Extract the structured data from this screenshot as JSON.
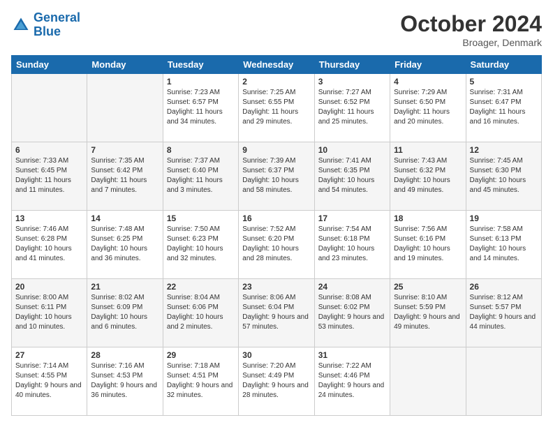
{
  "header": {
    "logo_line1": "General",
    "logo_line2": "Blue",
    "month": "October 2024",
    "location": "Broager, Denmark"
  },
  "weekdays": [
    "Sunday",
    "Monday",
    "Tuesday",
    "Wednesday",
    "Thursday",
    "Friday",
    "Saturday"
  ],
  "weeks": [
    [
      {
        "day": "",
        "sunrise": "",
        "sunset": "",
        "daylight": ""
      },
      {
        "day": "",
        "sunrise": "",
        "sunset": "",
        "daylight": ""
      },
      {
        "day": "1",
        "sunrise": "Sunrise: 7:23 AM",
        "sunset": "Sunset: 6:57 PM",
        "daylight": "Daylight: 11 hours and 34 minutes."
      },
      {
        "day": "2",
        "sunrise": "Sunrise: 7:25 AM",
        "sunset": "Sunset: 6:55 PM",
        "daylight": "Daylight: 11 hours and 29 minutes."
      },
      {
        "day": "3",
        "sunrise": "Sunrise: 7:27 AM",
        "sunset": "Sunset: 6:52 PM",
        "daylight": "Daylight: 11 hours and 25 minutes."
      },
      {
        "day": "4",
        "sunrise": "Sunrise: 7:29 AM",
        "sunset": "Sunset: 6:50 PM",
        "daylight": "Daylight: 11 hours and 20 minutes."
      },
      {
        "day": "5",
        "sunrise": "Sunrise: 7:31 AM",
        "sunset": "Sunset: 6:47 PM",
        "daylight": "Daylight: 11 hours and 16 minutes."
      }
    ],
    [
      {
        "day": "6",
        "sunrise": "Sunrise: 7:33 AM",
        "sunset": "Sunset: 6:45 PM",
        "daylight": "Daylight: 11 hours and 11 minutes."
      },
      {
        "day": "7",
        "sunrise": "Sunrise: 7:35 AM",
        "sunset": "Sunset: 6:42 PM",
        "daylight": "Daylight: 11 hours and 7 minutes."
      },
      {
        "day": "8",
        "sunrise": "Sunrise: 7:37 AM",
        "sunset": "Sunset: 6:40 PM",
        "daylight": "Daylight: 11 hours and 3 minutes."
      },
      {
        "day": "9",
        "sunrise": "Sunrise: 7:39 AM",
        "sunset": "Sunset: 6:37 PM",
        "daylight": "Daylight: 10 hours and 58 minutes."
      },
      {
        "day": "10",
        "sunrise": "Sunrise: 7:41 AM",
        "sunset": "Sunset: 6:35 PM",
        "daylight": "Daylight: 10 hours and 54 minutes."
      },
      {
        "day": "11",
        "sunrise": "Sunrise: 7:43 AM",
        "sunset": "Sunset: 6:32 PM",
        "daylight": "Daylight: 10 hours and 49 minutes."
      },
      {
        "day": "12",
        "sunrise": "Sunrise: 7:45 AM",
        "sunset": "Sunset: 6:30 PM",
        "daylight": "Daylight: 10 hours and 45 minutes."
      }
    ],
    [
      {
        "day": "13",
        "sunrise": "Sunrise: 7:46 AM",
        "sunset": "Sunset: 6:28 PM",
        "daylight": "Daylight: 10 hours and 41 minutes."
      },
      {
        "day": "14",
        "sunrise": "Sunrise: 7:48 AM",
        "sunset": "Sunset: 6:25 PM",
        "daylight": "Daylight: 10 hours and 36 minutes."
      },
      {
        "day": "15",
        "sunrise": "Sunrise: 7:50 AM",
        "sunset": "Sunset: 6:23 PM",
        "daylight": "Daylight: 10 hours and 32 minutes."
      },
      {
        "day": "16",
        "sunrise": "Sunrise: 7:52 AM",
        "sunset": "Sunset: 6:20 PM",
        "daylight": "Daylight: 10 hours and 28 minutes."
      },
      {
        "day": "17",
        "sunrise": "Sunrise: 7:54 AM",
        "sunset": "Sunset: 6:18 PM",
        "daylight": "Daylight: 10 hours and 23 minutes."
      },
      {
        "day": "18",
        "sunrise": "Sunrise: 7:56 AM",
        "sunset": "Sunset: 6:16 PM",
        "daylight": "Daylight: 10 hours and 19 minutes."
      },
      {
        "day": "19",
        "sunrise": "Sunrise: 7:58 AM",
        "sunset": "Sunset: 6:13 PM",
        "daylight": "Daylight: 10 hours and 14 minutes."
      }
    ],
    [
      {
        "day": "20",
        "sunrise": "Sunrise: 8:00 AM",
        "sunset": "Sunset: 6:11 PM",
        "daylight": "Daylight: 10 hours and 10 minutes."
      },
      {
        "day": "21",
        "sunrise": "Sunrise: 8:02 AM",
        "sunset": "Sunset: 6:09 PM",
        "daylight": "Daylight: 10 hours and 6 minutes."
      },
      {
        "day": "22",
        "sunrise": "Sunrise: 8:04 AM",
        "sunset": "Sunset: 6:06 PM",
        "daylight": "Daylight: 10 hours and 2 minutes."
      },
      {
        "day": "23",
        "sunrise": "Sunrise: 8:06 AM",
        "sunset": "Sunset: 6:04 PM",
        "daylight": "Daylight: 9 hours and 57 minutes."
      },
      {
        "day": "24",
        "sunrise": "Sunrise: 8:08 AM",
        "sunset": "Sunset: 6:02 PM",
        "daylight": "Daylight: 9 hours and 53 minutes."
      },
      {
        "day": "25",
        "sunrise": "Sunrise: 8:10 AM",
        "sunset": "Sunset: 5:59 PM",
        "daylight": "Daylight: 9 hours and 49 minutes."
      },
      {
        "day": "26",
        "sunrise": "Sunrise: 8:12 AM",
        "sunset": "Sunset: 5:57 PM",
        "daylight": "Daylight: 9 hours and 44 minutes."
      }
    ],
    [
      {
        "day": "27",
        "sunrise": "Sunrise: 7:14 AM",
        "sunset": "Sunset: 4:55 PM",
        "daylight": "Daylight: 9 hours and 40 minutes."
      },
      {
        "day": "28",
        "sunrise": "Sunrise: 7:16 AM",
        "sunset": "Sunset: 4:53 PM",
        "daylight": "Daylight: 9 hours and 36 minutes."
      },
      {
        "day": "29",
        "sunrise": "Sunrise: 7:18 AM",
        "sunset": "Sunset: 4:51 PM",
        "daylight": "Daylight: 9 hours and 32 minutes."
      },
      {
        "day": "30",
        "sunrise": "Sunrise: 7:20 AM",
        "sunset": "Sunset: 4:49 PM",
        "daylight": "Daylight: 9 hours and 28 minutes."
      },
      {
        "day": "31",
        "sunrise": "Sunrise: 7:22 AM",
        "sunset": "Sunset: 4:46 PM",
        "daylight": "Daylight: 9 hours and 24 minutes."
      },
      {
        "day": "",
        "sunrise": "",
        "sunset": "",
        "daylight": ""
      },
      {
        "day": "",
        "sunrise": "",
        "sunset": "",
        "daylight": ""
      }
    ]
  ]
}
